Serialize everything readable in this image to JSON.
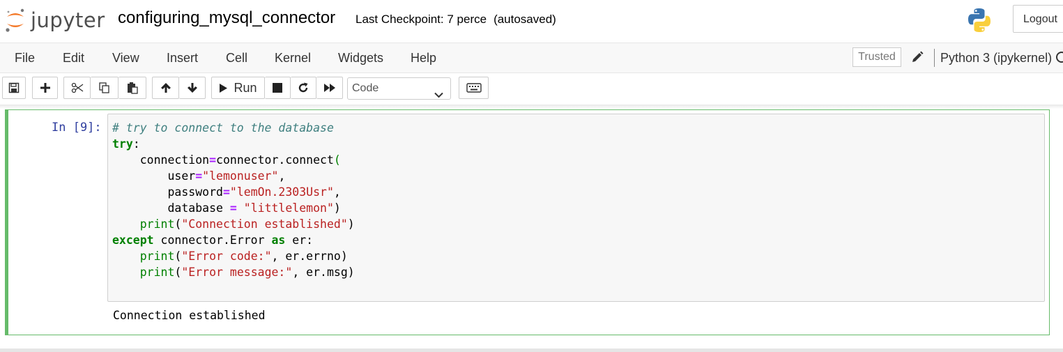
{
  "header": {
    "logo_text": "jupyter",
    "notebook_title": "configuring_mysql_connector",
    "checkpoint_text": "Last Checkpoint: 7 perce",
    "autosave_text": "(autosaved)",
    "logout_label": "Logout"
  },
  "menubar": {
    "items": [
      "File",
      "Edit",
      "View",
      "Insert",
      "Cell",
      "Kernel",
      "Widgets",
      "Help"
    ],
    "trusted_label": "Trusted",
    "kernel_name": "Python 3 (ipykernel)"
  },
  "toolbar": {
    "run_label": "Run",
    "cell_type": "Code",
    "icons": [
      "save-icon",
      "plus-icon",
      "cut-icon",
      "copy-icon",
      "paste-icon",
      "arrow-up-icon",
      "arrow-down-icon",
      "play-icon",
      "stop-icon",
      "restart-icon",
      "fast-forward-icon",
      "keyboard-icon"
    ]
  },
  "cell": {
    "prompt": "In [9]:",
    "code_lines": [
      "# try to connect to the database",
      "try:",
      "    connection=connector.connect(",
      "        user=\"lemonuser\",",
      "        password=\"lemOn.2303Usr\",",
      "        database = \"littlelemon\")",
      "    print(\"Connection established\")",
      "except connector.Error as er:",
      "    print(\"Error code:\", er.errno)",
      "    print(\"Error message:\", er.msg)"
    ],
    "output": "Connection established"
  },
  "colors": {
    "accent_green": "#66bb6a",
    "prompt_blue": "#303f9f",
    "jupyter_orange": "#f37726"
  }
}
